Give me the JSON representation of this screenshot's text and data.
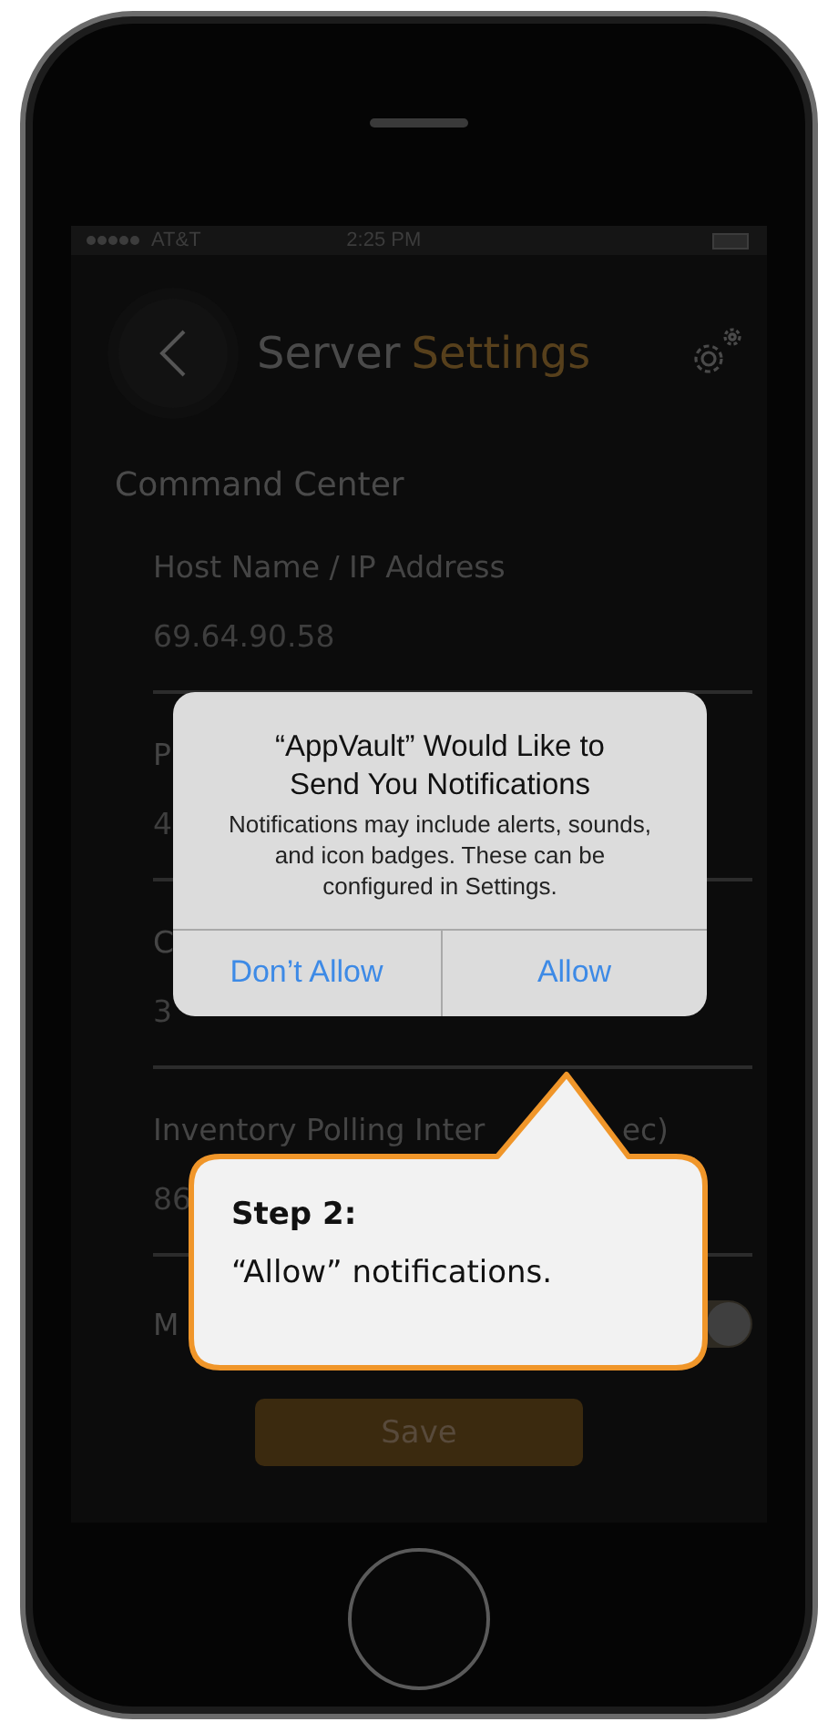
{
  "status_bar": {
    "carrier": "AT&T",
    "time": "2:25 PM"
  },
  "header": {
    "title_first": "Server",
    "title_second": "Settings"
  },
  "section": "Command Center",
  "fields": [
    {
      "label": "Host Name / IP Address",
      "value": "69.64.90.58"
    },
    {
      "label": "P",
      "value": "4"
    },
    {
      "label": "C",
      "value": "3"
    },
    {
      "label": "Inventory Polling Inter",
      "label_tail": "ec)",
      "value": "86"
    }
  ],
  "toggle_row": {
    "label": "M",
    "on": true
  },
  "save_button": "Save",
  "dialog": {
    "title": "“AppVault” Would Like to Send You Notifications",
    "message": "Notifications may include alerts, sounds, and icon badges. These can be configured in Settings.",
    "buttons": [
      "Don’t Allow",
      "Allow"
    ]
  },
  "callout": {
    "heading": "Step 2:",
    "text": "“Allow” notifications."
  }
}
